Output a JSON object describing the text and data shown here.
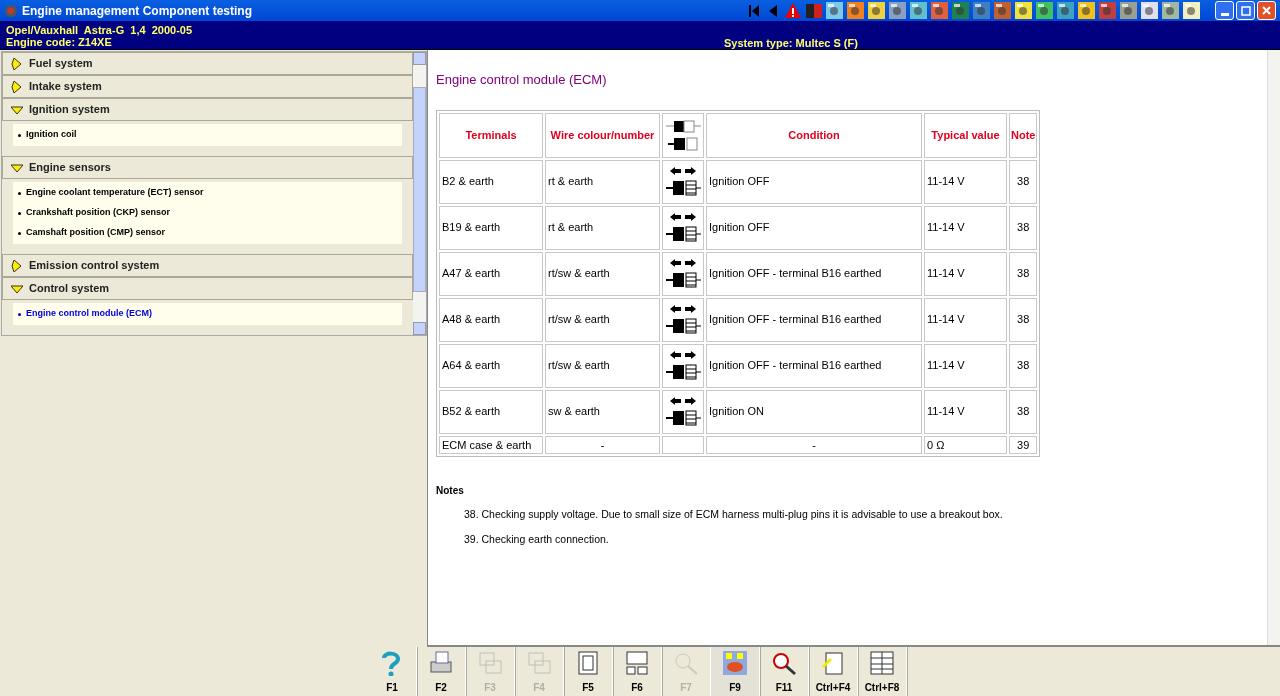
{
  "window": {
    "title": "Engine management Component testing"
  },
  "vehicle": {
    "line_1": "Opel/Vauxhall  Astra-G  1,4  2000-05",
    "line_2": "Engine code: Z14XE",
    "system_type": "System type: Multec S (F)"
  },
  "sidebar": {
    "sections": [
      {
        "label": "Fuel system",
        "expanded": false
      },
      {
        "label": "Intake system",
        "expanded": false
      },
      {
        "label": "Ignition system",
        "expanded": true,
        "children": [
          {
            "label": "Ignition coil",
            "selected": false
          }
        ]
      },
      {
        "label": "Engine sensors",
        "expanded": true,
        "children": [
          {
            "label": "Engine coolant temperature (ECT) sensor",
            "selected": false
          },
          {
            "label": "Crankshaft position (CKP) sensor",
            "selected": false
          },
          {
            "label": "Camshaft position (CMP) sensor",
            "selected": false
          }
        ]
      },
      {
        "label": "Emission control system",
        "expanded": false
      },
      {
        "label": "Control system",
        "expanded": true,
        "children": [
          {
            "label": "Engine control module (ECM)",
            "selected": true
          }
        ]
      }
    ]
  },
  "content": {
    "title": "Engine control module (ECM)",
    "table": {
      "columns": [
        "Terminals",
        "Wire colour/number",
        "Condition",
        "Typical value",
        "Note"
      ],
      "rows": [
        {
          "terminals": "B2 & earth",
          "wire": "rt & earth",
          "connector_diagram": true,
          "condition": "Ignition OFF",
          "typical_value": "11-14 V",
          "note": "38"
        },
        {
          "terminals": "B19 & earth",
          "wire": "rt & earth",
          "connector_diagram": true,
          "condition": "Ignition OFF",
          "typical_value": "11-14 V",
          "note": "38"
        },
        {
          "terminals": "A47 & earth",
          "wire": "rt/sw & earth",
          "connector_diagram": true,
          "condition": "Ignition OFF - terminal B16 earthed",
          "typical_value": "11-14 V",
          "note": "38"
        },
        {
          "terminals": "A48 & earth",
          "wire": "rt/sw & earth",
          "connector_diagram": true,
          "condition": "Ignition OFF - terminal B16 earthed",
          "typical_value": "11-14 V",
          "note": "38"
        },
        {
          "terminals": "A64 & earth",
          "wire": "rt/sw & earth",
          "connector_diagram": true,
          "condition": "Ignition OFF - terminal B16 earthed",
          "typical_value": "11-14 V",
          "note": "38"
        },
        {
          "terminals": "B52 & earth",
          "wire": "sw & earth",
          "connector_diagram": true,
          "condition": "Ignition ON",
          "typical_value": "11-14 V",
          "note": "38"
        },
        {
          "terminals": "ECM case & earth",
          "wire": "-",
          "connector_diagram": false,
          "condition": "-",
          "typical_value": "0 Ω",
          "note": "39"
        }
      ]
    },
    "notes_title": "Notes",
    "notes": [
      "38. Checking supply voltage. Due to small size of ECM harness multi-plug pins it is advisable to use a breakout box.",
      "39. Checking earth connection."
    ]
  },
  "function_keys": [
    {
      "label": "F1",
      "disabled": false
    },
    {
      "label": "F2",
      "disabled": false
    },
    {
      "label": "F3",
      "disabled": true
    },
    {
      "label": "F4",
      "disabled": true
    },
    {
      "label": "F5",
      "disabled": false
    },
    {
      "label": "F6",
      "disabled": false
    },
    {
      "label": "F7",
      "disabled": true
    },
    {
      "label": "F9",
      "disabled": false
    },
    {
      "label": "F11",
      "disabled": false
    },
    {
      "label": "Ctrl+F4",
      "disabled": false
    },
    {
      "label": "Ctrl+F8",
      "disabled": false
    }
  ]
}
